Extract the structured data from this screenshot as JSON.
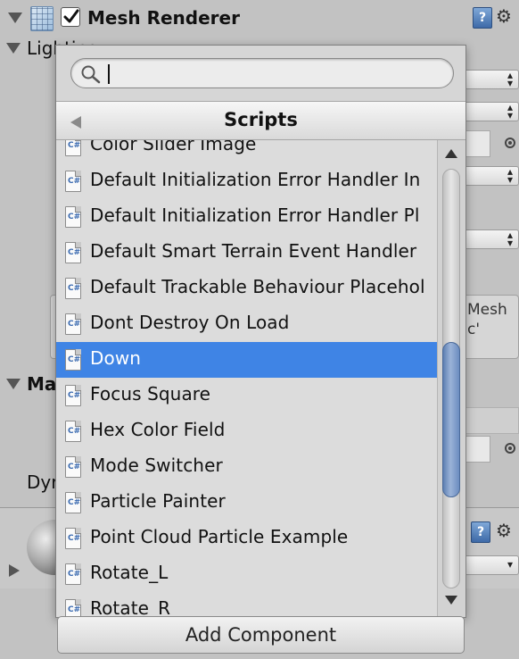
{
  "component": {
    "title": "Mesh Renderer",
    "enabled": true,
    "help_icon": "help-book-icon",
    "gear_icon": "gear-icon"
  },
  "background": {
    "lighting_label": "Lighting",
    "materials_label_partial": "Ma",
    "dyn_label_partial": "Dyr",
    "info_text_line1": "Mesh",
    "info_text_line2": "c'"
  },
  "popup": {
    "search": {
      "value": "",
      "placeholder": ""
    },
    "category_title": "Scripts",
    "items": [
      {
        "label": "Color Slider Image"
      },
      {
        "label": "Default Initialization Error Handler In"
      },
      {
        "label": "Default Initialization Error Handler Pl"
      },
      {
        "label": "Default Smart Terrain Event Handler"
      },
      {
        "label": "Default Trackable Behaviour Placehol"
      },
      {
        "label": "Dont Destroy On Load"
      },
      {
        "label": "Down",
        "selected": true
      },
      {
        "label": "Focus Square"
      },
      {
        "label": "Hex Color Field"
      },
      {
        "label": "Mode Switcher"
      },
      {
        "label": "Particle Painter"
      },
      {
        "label": "Point Cloud Particle Example"
      },
      {
        "label": "Rotate_L"
      },
      {
        "label": "Rotate_R"
      }
    ],
    "item_icon": "csharp-script-icon",
    "scroll_position": 0.55
  },
  "add_component_label": "Add Component",
  "colors": {
    "selection": "#3f84e5",
    "panel": "#c2c2c2",
    "popup": "#dcdcdc"
  }
}
